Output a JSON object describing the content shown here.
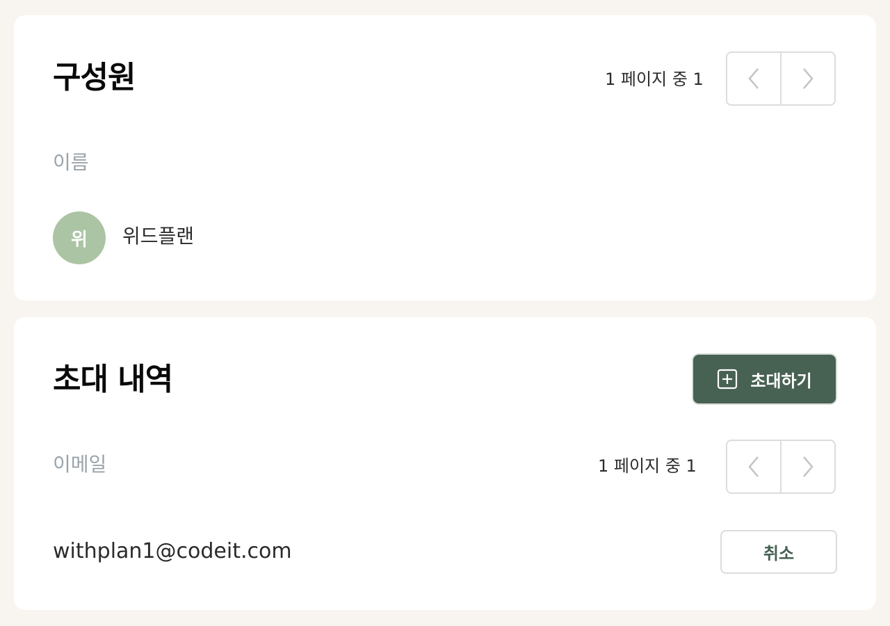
{
  "members": {
    "title": "구성원",
    "pagination": {
      "text": "1 페이지 중 1",
      "prev_icon": "chevron-left-icon",
      "next_icon": "chevron-right-icon"
    },
    "column_header": "이름",
    "rows": [
      {
        "avatar_initial": "위",
        "name": "위드플랜",
        "avatar_color": "#abc4a4"
      }
    ]
  },
  "invites": {
    "title": "초대 내역",
    "invite_button": {
      "label": "초대하기",
      "icon": "plus-square-icon",
      "color": "#476153"
    },
    "column_header": "이메일",
    "pagination": {
      "text": "1 페이지 중 1",
      "prev_icon": "chevron-left-icon",
      "next_icon": "chevron-right-icon"
    },
    "rows": [
      {
        "email": "withplan1@codeit.com",
        "cancel_label": "취소"
      }
    ]
  },
  "colors": {
    "background": "#f8f5f0",
    "card": "#ffffff",
    "accent": "#476153",
    "muted_text": "#9aa2aa"
  }
}
